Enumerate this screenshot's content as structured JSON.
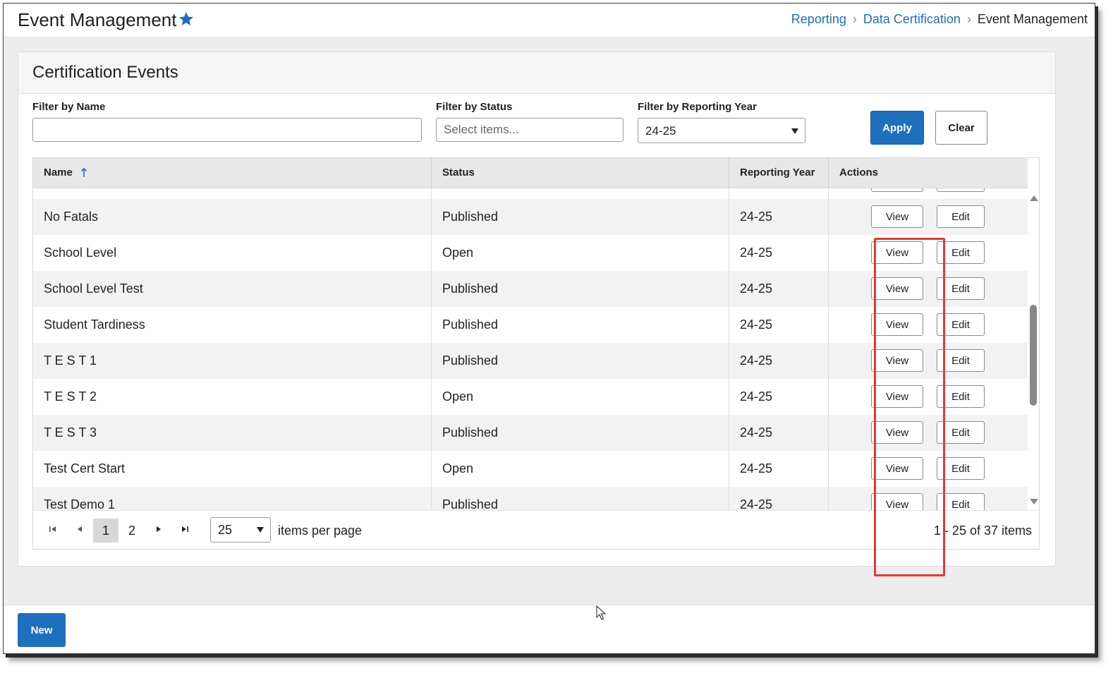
{
  "header": {
    "title": "Event Management",
    "breadcrumb": [
      "Reporting",
      "Data Certification",
      "Event Management"
    ]
  },
  "card": {
    "title": "Certification Events",
    "filters": {
      "name_label": "Filter by Name",
      "name_value": "",
      "status_label": "Filter by Status",
      "status_placeholder": "Select items...",
      "year_label": "Filter by Reporting Year",
      "year_value": "24-25",
      "apply_label": "Apply",
      "clear_label": "Clear"
    },
    "table": {
      "columns": [
        "Name",
        "Status",
        "Reporting Year",
        "Actions"
      ],
      "view_label": "View",
      "edit_label": "Edit",
      "rows": [
        {
          "name": "No Fatals",
          "status": "Published",
          "year": "24-25"
        },
        {
          "name": "School Level",
          "status": "Open",
          "year": "24-25"
        },
        {
          "name": "School Level Test",
          "status": "Published",
          "year": "24-25"
        },
        {
          "name": "Student Tardiness",
          "status": "Published",
          "year": "24-25"
        },
        {
          "name": "T E S T 1",
          "status": "Published",
          "year": "24-25"
        },
        {
          "name": "T E S T 2",
          "status": "Open",
          "year": "24-25"
        },
        {
          "name": "T E S T 3",
          "status": "Published",
          "year": "24-25"
        },
        {
          "name": "Test Cert Start",
          "status": "Open",
          "year": "24-25"
        },
        {
          "name": "Test Demo 1",
          "status": "Published",
          "year": "24-25"
        }
      ]
    },
    "pager": {
      "pages": [
        "1",
        "2"
      ],
      "current_page": "1",
      "page_size": "25",
      "per_page_label": "items per page",
      "info": "1 - 25 of 37 items"
    }
  },
  "footer": {
    "new_label": "New"
  },
  "colors": {
    "primary": "#1f6fbf",
    "highlight": "#e53935"
  }
}
